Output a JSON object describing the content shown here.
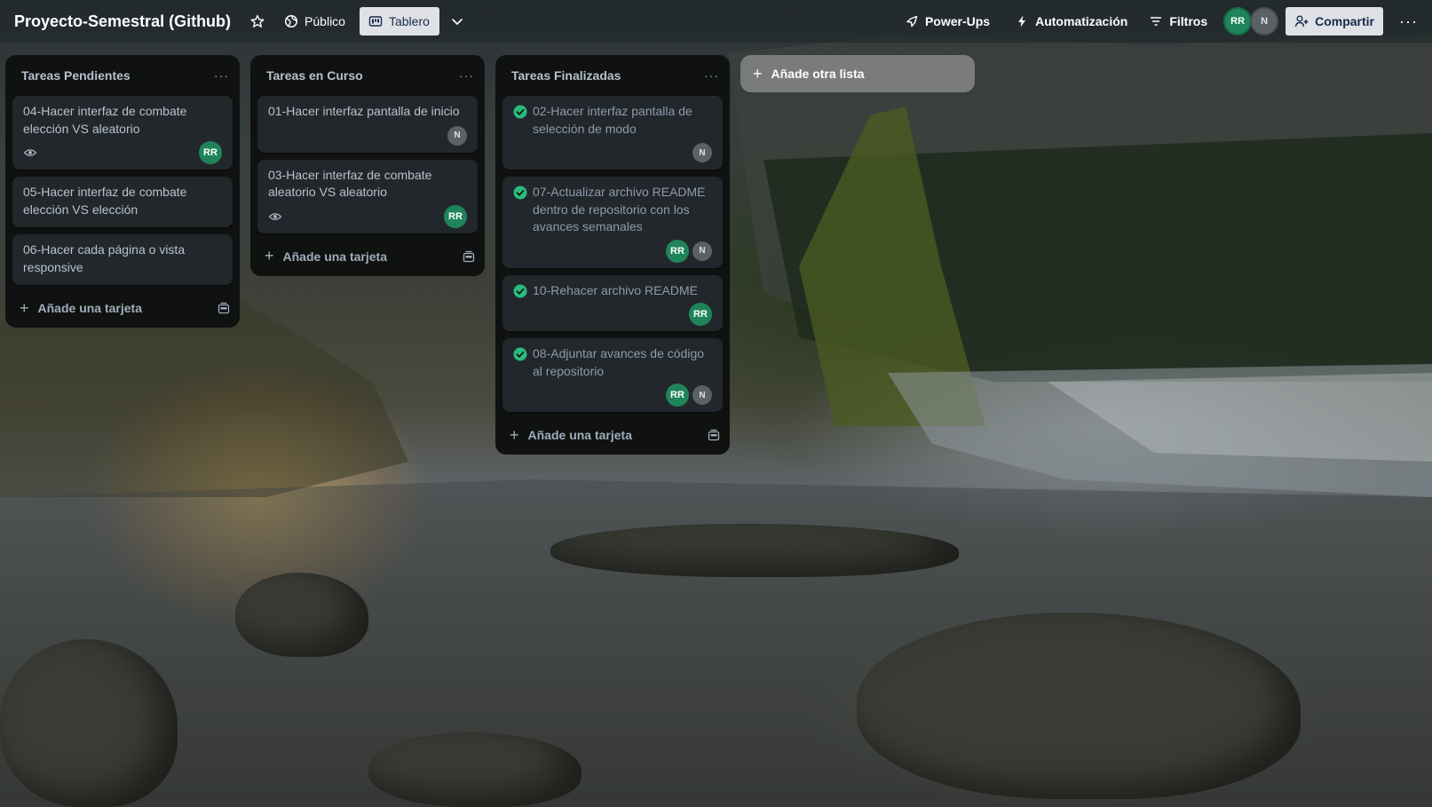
{
  "header": {
    "board_title": "Proyecto-Semestral (Github)",
    "visibility_label": "Público",
    "view_label": "Tablero",
    "powerups_label": "Power-Ups",
    "automation_label": "Automatización",
    "filters_label": "Filtros",
    "share_label": "Compartir",
    "members": [
      "RR",
      "N"
    ]
  },
  "lists": [
    {
      "title": "Tareas Pendientes",
      "cards": [
        {
          "title": "04-Hacer interfaz de combate elección VS aleatorio",
          "members": [
            "RR"
          ]
        },
        {
          "title": "05-Hacer interfaz de combate elección VS elección"
        },
        {
          "title": "06-Hacer cada página o vista responsive"
        }
      ],
      "add_card_label": "Añade una tarjeta"
    },
    {
      "title": "Tareas en Curso",
      "cards": [
        {
          "title": "01-Hacer interfaz pantalla de inicio",
          "members": [
            "N"
          ]
        },
        {
          "title": "03-Hacer interfaz de combate aleatorio VS aleatorio",
          "members": [
            "RR"
          ]
        }
      ],
      "add_card_label": "Añade una tarjeta"
    },
    {
      "title": "Tareas Finalizadas",
      "cards": [
        {
          "title": "02-Hacer interfaz pantalla de selección de modo",
          "members": [
            "N"
          ]
        },
        {
          "title": "07-Actualizar archivo README dentro de repositorio con los avances semanales",
          "members": [
            "RR",
            "N"
          ]
        },
        {
          "title": "10-Rehacer archivo README",
          "members": [
            "RR"
          ]
        },
        {
          "title": "08-Adjuntar avances de código al repositorio",
          "members": [
            "RR",
            "N"
          ]
        }
      ],
      "add_card_label": "Añade una tarjeta"
    }
  ],
  "add_list_label": "Añade otra lista",
  "colors": {
    "member_rr": "#1f845a",
    "member_n": "#5a6167",
    "check_complete": "#2abb7f",
    "list_bg": "#0f1210",
    "card_bg": "#22272b"
  }
}
